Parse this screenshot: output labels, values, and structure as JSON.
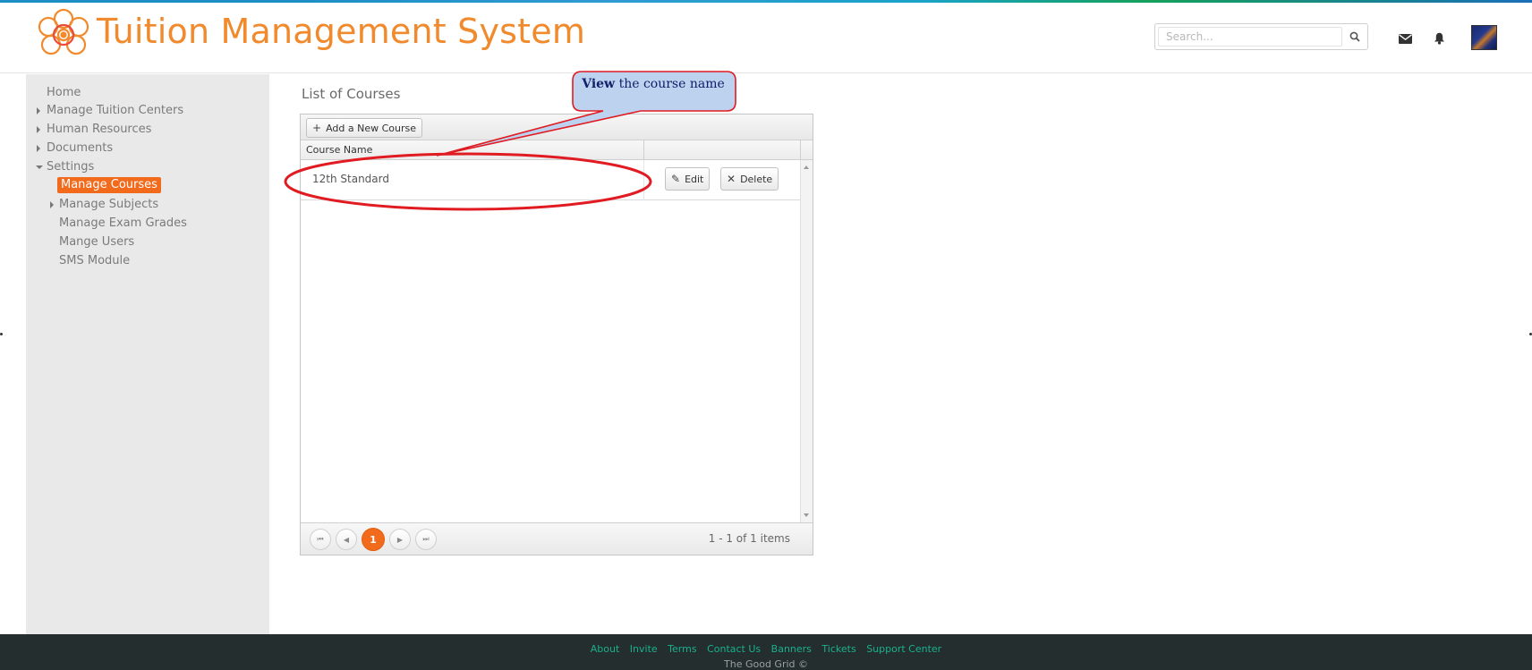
{
  "header": {
    "app_title": "Tuition Management System",
    "search_placeholder": "Search...",
    "icons": [
      "search-icon",
      "mail-icon",
      "bell-icon",
      "avatar"
    ]
  },
  "sidebar": {
    "items": [
      {
        "label": "Home",
        "arrow": "none"
      },
      {
        "label": "Manage Tuition Centers",
        "arrow": "right"
      },
      {
        "label": "Human Resources",
        "arrow": "right"
      },
      {
        "label": "Documents",
        "arrow": "right"
      },
      {
        "label": "Settings",
        "arrow": "down"
      },
      {
        "label": "Manage Courses",
        "arrow": "none",
        "active": true
      },
      {
        "label": "Manage Subjects",
        "arrow": "right"
      },
      {
        "label": "Manage Exam Grades",
        "arrow": "none"
      },
      {
        "label": "Mange Users",
        "arrow": "none"
      },
      {
        "label": "SMS Module",
        "arrow": "none"
      }
    ]
  },
  "main": {
    "heading": "List of Courses",
    "toolbar": {
      "add_label": "Add a New Course",
      "add_icon": "plus-icon"
    },
    "columns": [
      "Course Name",
      ""
    ],
    "rows": [
      {
        "course_name": "12th Standard",
        "edit_label": "Edit",
        "delete_label": "Delete"
      }
    ],
    "pager": {
      "current_page": "1",
      "info": "1 - 1 of 1 items"
    }
  },
  "callout": {
    "bold": "View",
    "text": " the course name"
  },
  "footer": {
    "links": [
      "About",
      "Invite",
      "Terms",
      "Contact Us",
      "Banners",
      "Tickets",
      "Support Center"
    ],
    "copyright": "The Good Grid ©"
  },
  "colors": {
    "brand": "#f08a2c",
    "active": "#f26a1b",
    "footer_bg": "#242e2e",
    "footer_link": "#1ab08e",
    "annotation": "#e01b22"
  }
}
